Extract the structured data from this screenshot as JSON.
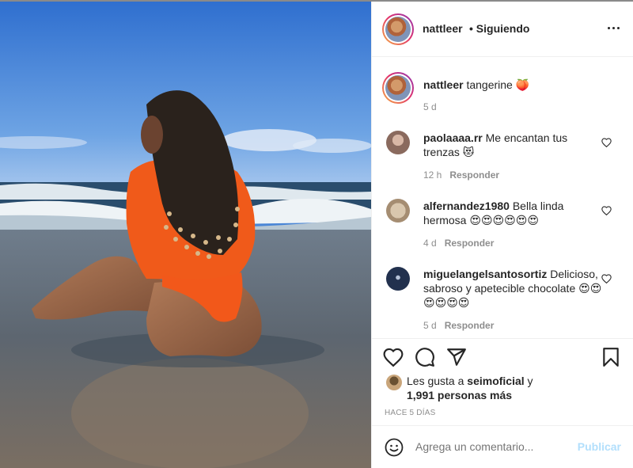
{
  "post": {
    "photo_alt_icon": "beach-photo",
    "author": "nattleer",
    "follow_status": "• Siguiendo",
    "more_icon": "more-options-icon"
  },
  "caption": {
    "username": "nattleer",
    "text": "tangerine 🍑",
    "time": "5 d"
  },
  "comments": [
    {
      "username": "paolaaaa.rr",
      "text": "Me encantan tus trenzas 😻",
      "time": "12 h",
      "reply": "Responder",
      "avatar_color": "#b08a7a"
    },
    {
      "username": "alfernandez1980",
      "text": "Bella linda hermosa 😍😍😍😍😍😍",
      "time": "4 d",
      "reply": "Responder",
      "avatar_color": "#c8b8a0"
    },
    {
      "username": "miguelangelsantosortiz",
      "text": "Delicioso, sabroso y apetecible chocolate 😍😍😍😍😍😍",
      "time": "5 d",
      "reply": "Responder",
      "avatar_color": "#1c2a44"
    }
  ],
  "actions": {
    "like_icon": "heart-icon",
    "comment_icon": "comment-icon",
    "share_icon": "share-icon",
    "save_icon": "bookmark-icon"
  },
  "likes": {
    "prefix": "Les gusta a",
    "user": "seimoficial",
    "connector": "y",
    "others": "1,991 personas más"
  },
  "posted_ago": "HACE 5 DÍAS",
  "add_comment": {
    "placeholder": "Agrega un comentario...",
    "publish_label": "Publicar"
  },
  "colors": {
    "text": "#262626",
    "muted": "#8e8e8e",
    "publish_disabled": "#b2dffc",
    "divider": "#efefef"
  }
}
